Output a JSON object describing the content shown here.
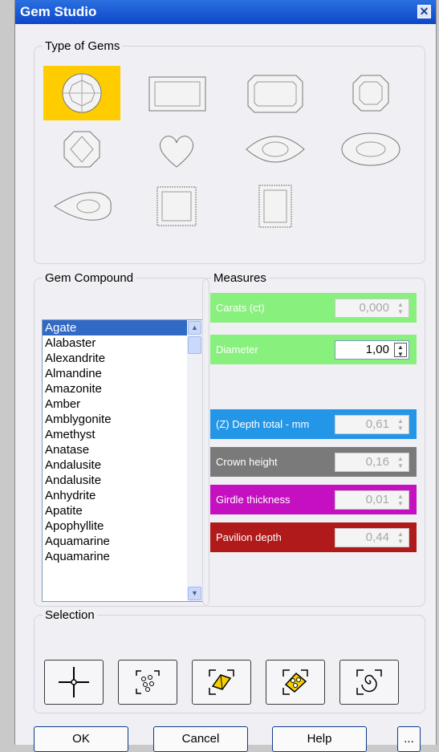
{
  "window": {
    "title": "Gem Studio",
    "close_icon": "close-icon"
  },
  "gem_types": {
    "legend": "Type of Gems",
    "selected_index": 0,
    "items": [
      "round",
      "emerald-cut-rectangle",
      "octagon-emerald-cut",
      "asscher-octagon",
      "octagon-brilliant",
      "heart",
      "marquise",
      "oval",
      "pear",
      "princess-square",
      "radiant-rectangle"
    ]
  },
  "compound": {
    "legend": "Gem Compound",
    "selected": "Agate",
    "items": [
      "Agate",
      "Alabaster",
      "Alexandrite",
      "Almandine",
      "Amazonite",
      "Amber",
      "Amblygonite",
      "Amethyst",
      "Anatase",
      "Andalusite",
      "Andalusite",
      "Anhydrite",
      "Apatite",
      "Apophyllite",
      "Aquamarine",
      "Aquamarine"
    ]
  },
  "measures": {
    "legend": "Measures",
    "rows": [
      {
        "label": "Carats (ct)",
        "value": "0,000",
        "color": "#88f07c",
        "enabled": false
      },
      {
        "label": "Diameter",
        "value": "1,00",
        "color": "#88f07c",
        "enabled": true
      },
      {
        "label": "(Z) Depth total - mm",
        "value": "0,61",
        "color": "#2496e8",
        "enabled": false
      },
      {
        "label": "Crown height",
        "value": "0,16",
        "color": "#7a7a7a",
        "enabled": false
      },
      {
        "label": "Girdle thickness",
        "value": "0,01",
        "color": "#c410c0",
        "enabled": false
      },
      {
        "label": "Pavilion depth",
        "value": "0,44",
        "color": "#b01a1a",
        "enabled": false
      }
    ]
  },
  "selection": {
    "legend": "Selection",
    "tools": [
      "crosshair-select-icon",
      "scatter-dots-select-icon",
      "single-gem-select-icon",
      "multi-gem-select-icon",
      "spiral-select-icon"
    ]
  },
  "buttons": {
    "ok": "OK",
    "cancel": "Cancel",
    "help": "Help",
    "more": "..."
  }
}
